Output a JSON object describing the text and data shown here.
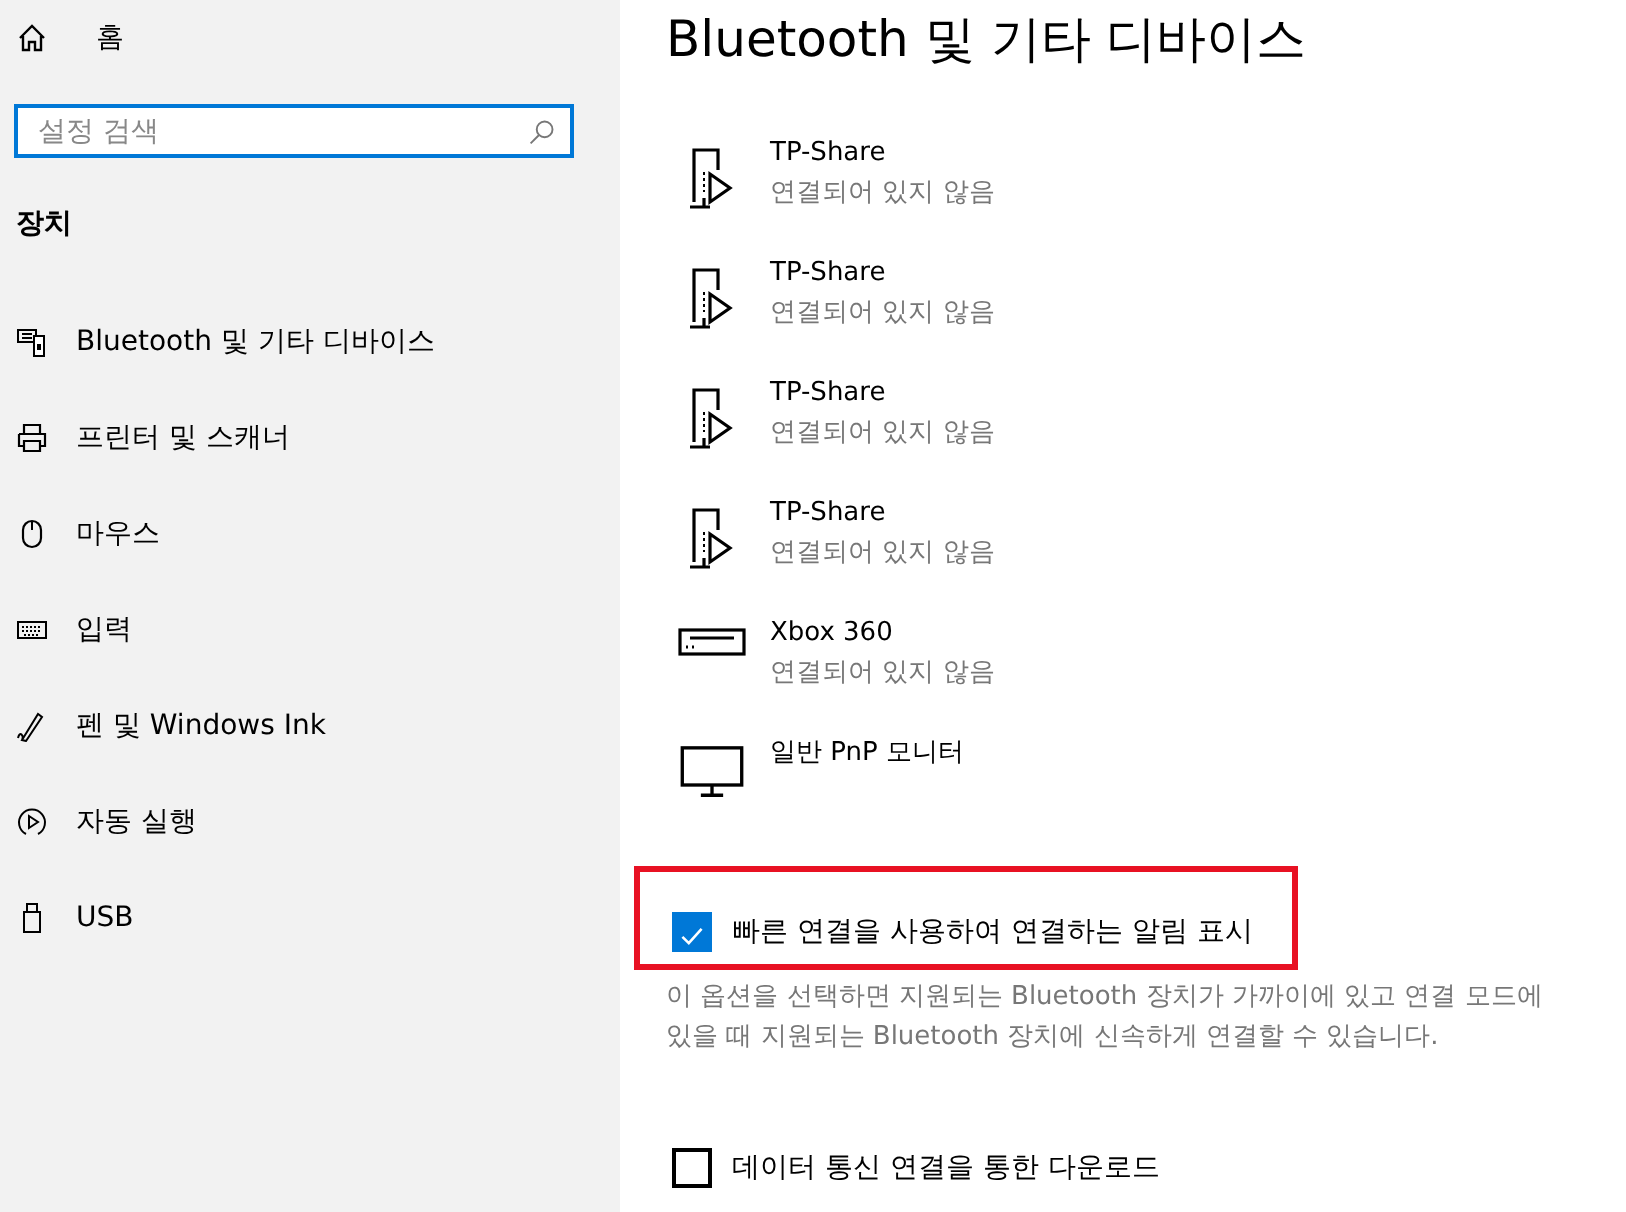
{
  "sidebar": {
    "home": "홈",
    "search": {
      "placeholder": "설정 검색"
    },
    "section": "장치",
    "items": [
      {
        "label": "Bluetooth 및 기타 디바이스",
        "kind": "bluetooth",
        "selected": false
      },
      {
        "label": "프린터 및 스캐너",
        "kind": "printer",
        "selected": false
      },
      {
        "label": "마우스",
        "kind": "mouse",
        "selected": false
      },
      {
        "label": "입력",
        "kind": "keyboard",
        "selected": false
      },
      {
        "label": "펜 및 Windows Ink",
        "kind": "pen",
        "selected": false
      },
      {
        "label": "자동 실행",
        "kind": "autoplay",
        "selected": false
      },
      {
        "label": "USB",
        "kind": "usb",
        "selected": false
      }
    ]
  },
  "title": "Bluetooth 및 기타 디바이스",
  "devices": [
    {
      "name": "TP-Share",
      "status": "연결되어 있지 않음",
      "kind": "share"
    },
    {
      "name": "TP-Share",
      "status": "연결되어 있지 않음",
      "kind": "share"
    },
    {
      "name": "TP-Share",
      "status": "연결되어 있지 않음",
      "kind": "share"
    },
    {
      "name": "TP-Share",
      "status": "연결되어 있지 않음",
      "kind": "share"
    },
    {
      "name": "Xbox 360",
      "status": "연결되어 있지 않음",
      "kind": "console"
    },
    {
      "name": "일반 PnP 모니터",
      "kind": "monitor"
    }
  ],
  "options": [
    {
      "label": "빠른 연결을 사용하여 연결하는 알림 표시",
      "checked": true,
      "highlighted": true,
      "description": "이 옵션을 선택하면 지원되는 Bluetooth 장치가 가까이에 있고 연결 모드에 있을 때 지원되는 Bluetooth 장치에 신속하게 연결할 수 있습니다."
    },
    {
      "label": "데이터 통신 연결을 통한 다운로드",
      "checked": false,
      "highlighted": false
    }
  ]
}
